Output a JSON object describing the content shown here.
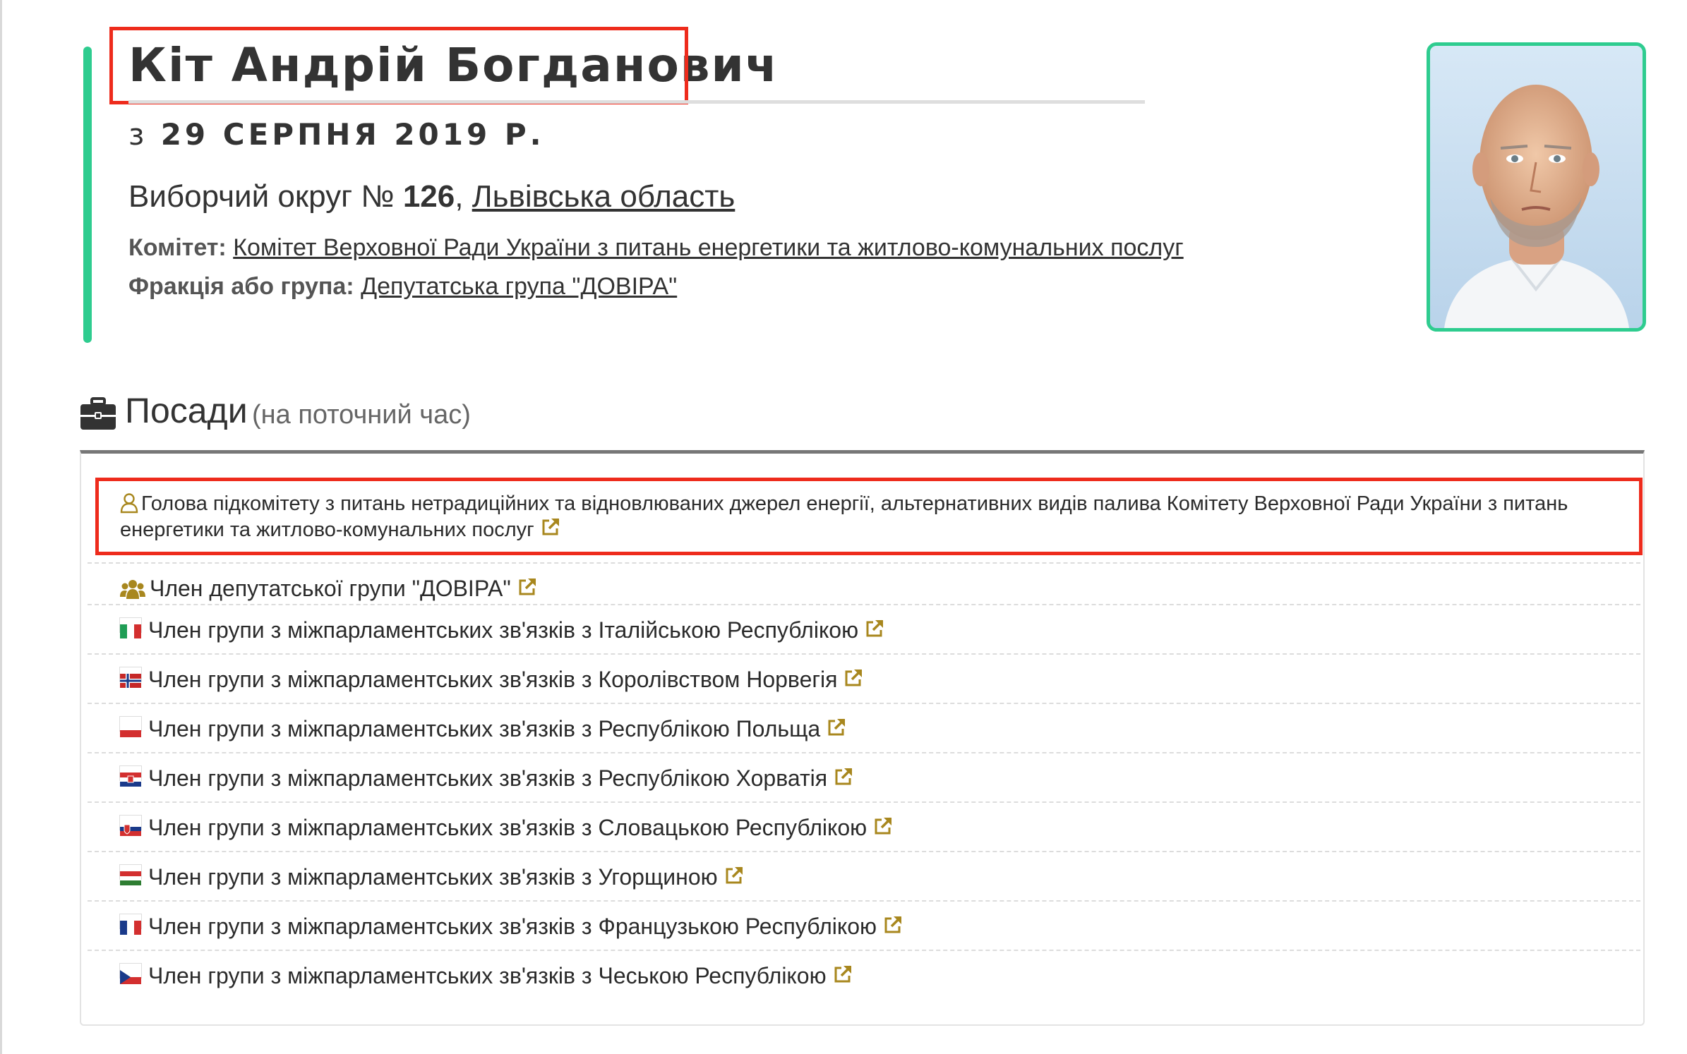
{
  "deputy": {
    "name": "Кіт Андрій Богданович",
    "since_prefix": "з",
    "since_date": "29 серпня 2019 р.",
    "district_prefix": "Виборчий округ №",
    "district_number": "126",
    "district_sep": ",",
    "region": "Львівська область",
    "committee_label": "Комітет:",
    "committee": "Комітет Верховної Ради України з питань енергетики та житлово-комунальних послуг",
    "faction_label": "Фракція або група:",
    "faction": "Депутатська група \"ДОВІРА\""
  },
  "positions": {
    "title": "Посади",
    "note": "(на поточний час)",
    "head_item": {
      "icon": "user-outline-icon",
      "text": "Голова підкомітету з питань нетрадиційних та відновлюваних джерел енергії, альтернативних видів палива Комітету Верховної Ради України з питань енергетики та житлово-комунальних послуг"
    },
    "items": [
      {
        "icon": "people-icon",
        "text": "Член депутатської групи \"ДОВІРА\""
      },
      {
        "icon": "flag-italy",
        "text": "Член групи з міжпарламентських зв'язків з Італійською Республікою"
      },
      {
        "icon": "flag-norway",
        "text": "Член групи з міжпарламентських зв'язків з Королівством Норвегія"
      },
      {
        "icon": "flag-poland",
        "text": "Член групи з міжпарламентських зв'язків з Республікою Польща"
      },
      {
        "icon": "flag-croatia",
        "text": "Член групи з міжпарламентських зв'язків з Республікою Хорватія"
      },
      {
        "icon": "flag-slovakia",
        "text": "Член групи з міжпарламентських зв'язків з Словацькою Республікою"
      },
      {
        "icon": "flag-hungary",
        "text": "Член групи з міжпарламентських зв'язків з Угорщиною"
      },
      {
        "icon": "flag-france",
        "text": "Член групи з міжпарламентських зв'язків з Французькою Республікою"
      },
      {
        "icon": "flag-czech",
        "text": "Член групи з міжпарламентських зв'язків з Чеською Республікою"
      }
    ]
  },
  "colors": {
    "accent_green": "#2ecc8f",
    "highlight_red": "#ee2b1c",
    "icon_gold": "#a8871e"
  }
}
